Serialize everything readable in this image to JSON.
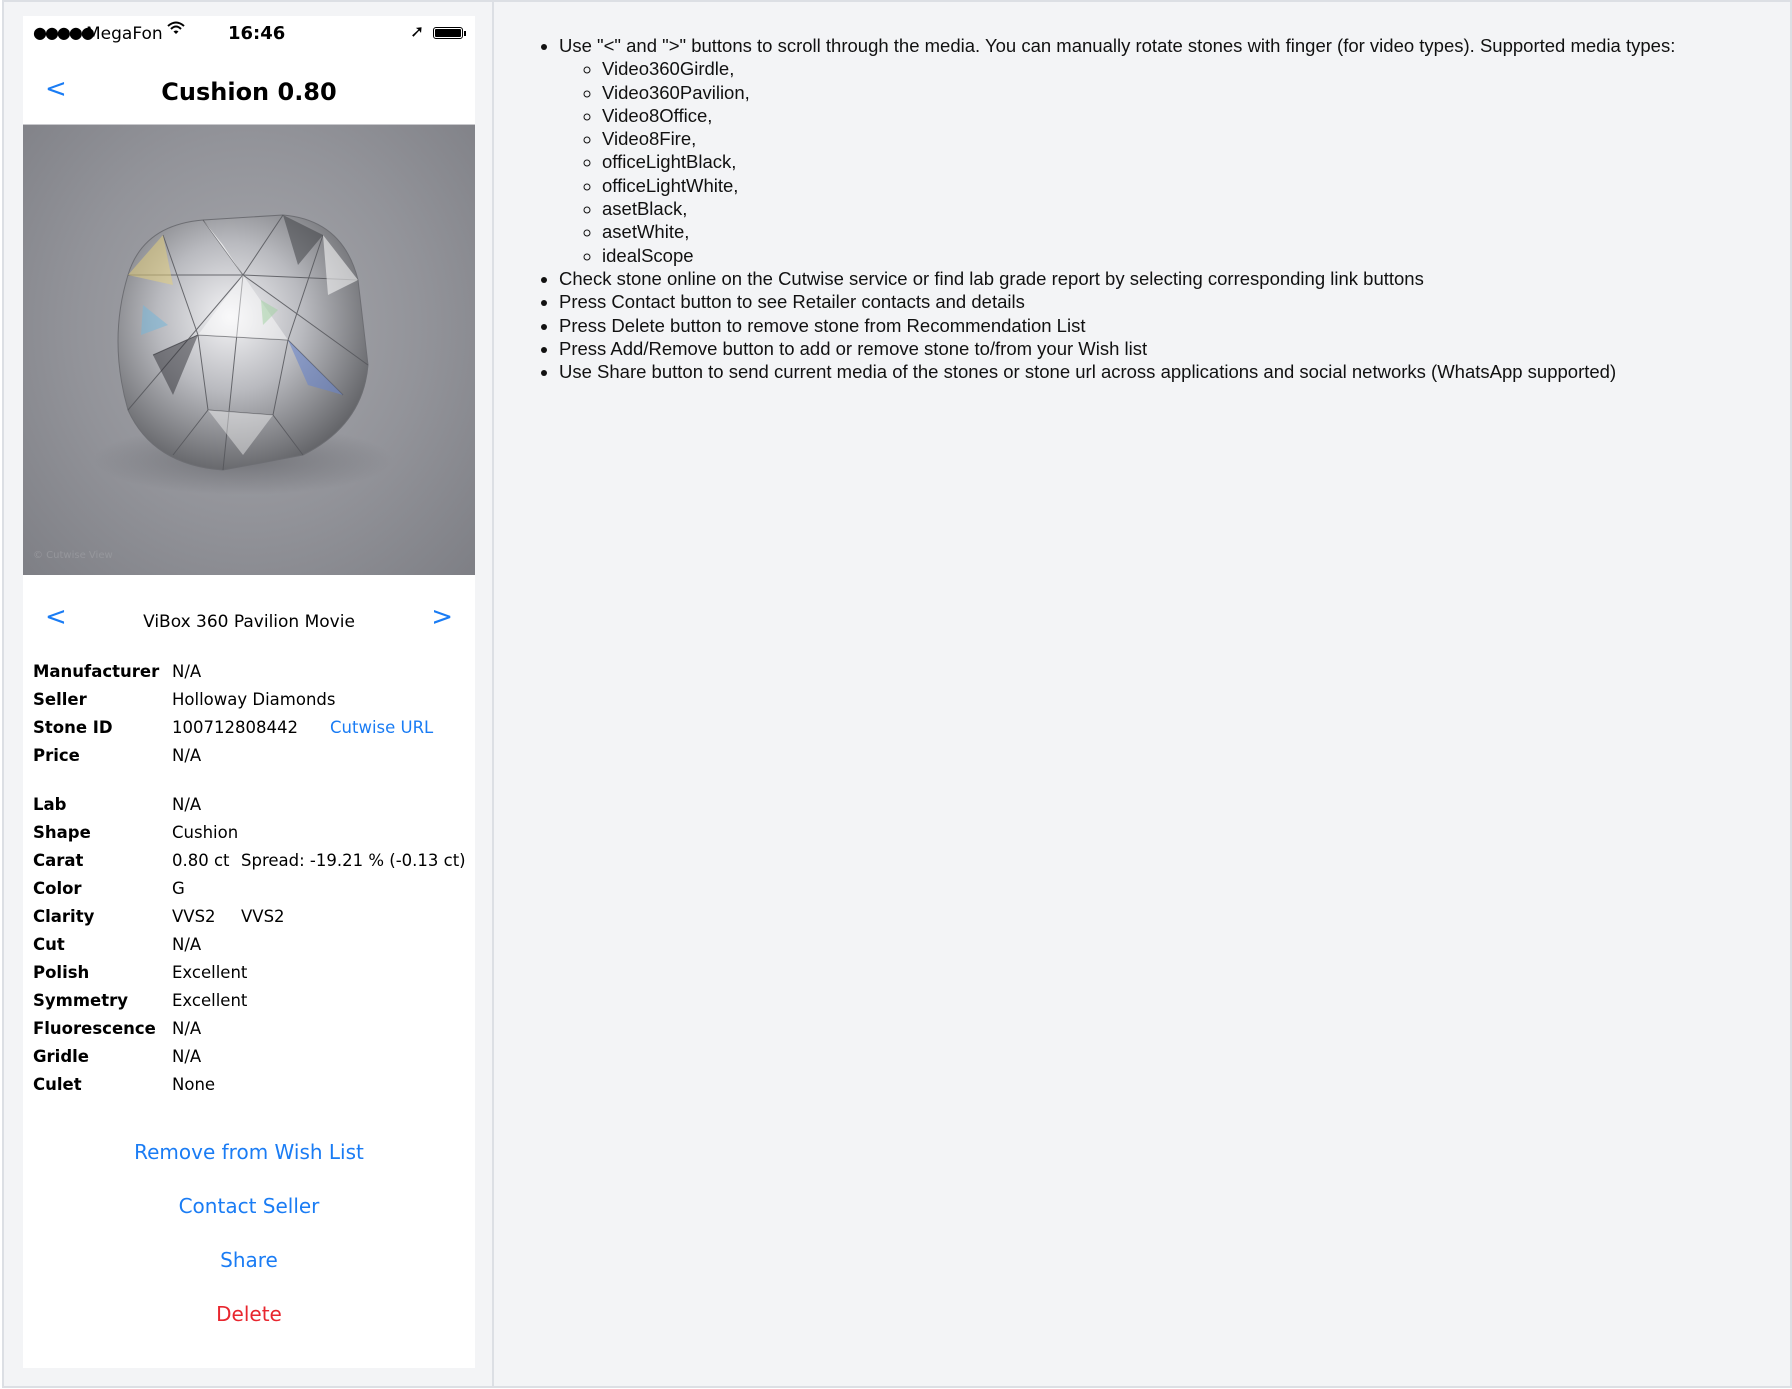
{
  "status_bar": {
    "signal": "●●●●●",
    "carrier": "MegaFon",
    "time": "16:46"
  },
  "nav": {
    "back": "<",
    "title": "Cushion 0.80"
  },
  "media": {
    "prev": "<",
    "next": ">",
    "label": "ViBox 360 Pavilion Movie"
  },
  "details": {
    "manufacturer": {
      "label": "Manufacturer",
      "value": "N/A"
    },
    "seller": {
      "label": "Seller",
      "value": "Holloway Diamonds"
    },
    "stone_id": {
      "label": "Stone ID",
      "value": "100712808442",
      "link": "Cutwise URL"
    },
    "price": {
      "label": "Price",
      "value": "N/A"
    },
    "lab": {
      "label": "Lab",
      "value": "N/A"
    },
    "shape": {
      "label": "Shape",
      "value": "Cushion"
    },
    "carat": {
      "label": "Carat",
      "value": "0.80 ct",
      "spread": "Spread: -19.21 % (-0.13 ct)"
    },
    "color": {
      "label": "Color",
      "value": "G"
    },
    "clarity": {
      "label": "Clarity",
      "value": "VVS2",
      "value2": "VVS2"
    },
    "cut": {
      "label": "Cut",
      "value": "N/A"
    },
    "polish": {
      "label": "Polish",
      "value": "Excellent"
    },
    "symmetry": {
      "label": "Symmetry",
      "value": "Excellent"
    },
    "fluorescence": {
      "label": "Fluorescence",
      "value": "N/A"
    },
    "gridle": {
      "label": "Gridle",
      "value": "N/A"
    },
    "culet": {
      "label": "Culet",
      "value": "None"
    }
  },
  "actions": {
    "remove": "Remove from Wish List",
    "contact": "Contact Seller",
    "share": "Share",
    "delete": "Delete"
  },
  "colors": {
    "accent": "#1a7cf4",
    "danger": "#e8262e",
    "page_bg": "#f3f4f6"
  },
  "doc": {
    "items": [
      "Use \"<\" and \">\" buttons to scroll through the media. You can manually rotate stones with finger (for video types). Supported media types:",
      "Check stone online on the Cutwise service or find lab grade report by selecting corresponding link buttons",
      "Press Contact button to see Retailer contacts and details",
      "Press Delete button to remove stone from Recommendation List",
      "Press Add/Remove button to add or remove stone to/from your Wish list",
      "Use Share button to send current media of the stones or stone url across applications and social networks (WhatsApp supported)"
    ],
    "media_types": [
      "Video360Girdle,",
      "Video360Pavilion,",
      "Video8Office,",
      "Video8Fire,",
      "officeLightBlack,",
      "officeLightWhite,",
      "asetBlack,",
      "asetWhite,",
      "idealScope"
    ]
  }
}
